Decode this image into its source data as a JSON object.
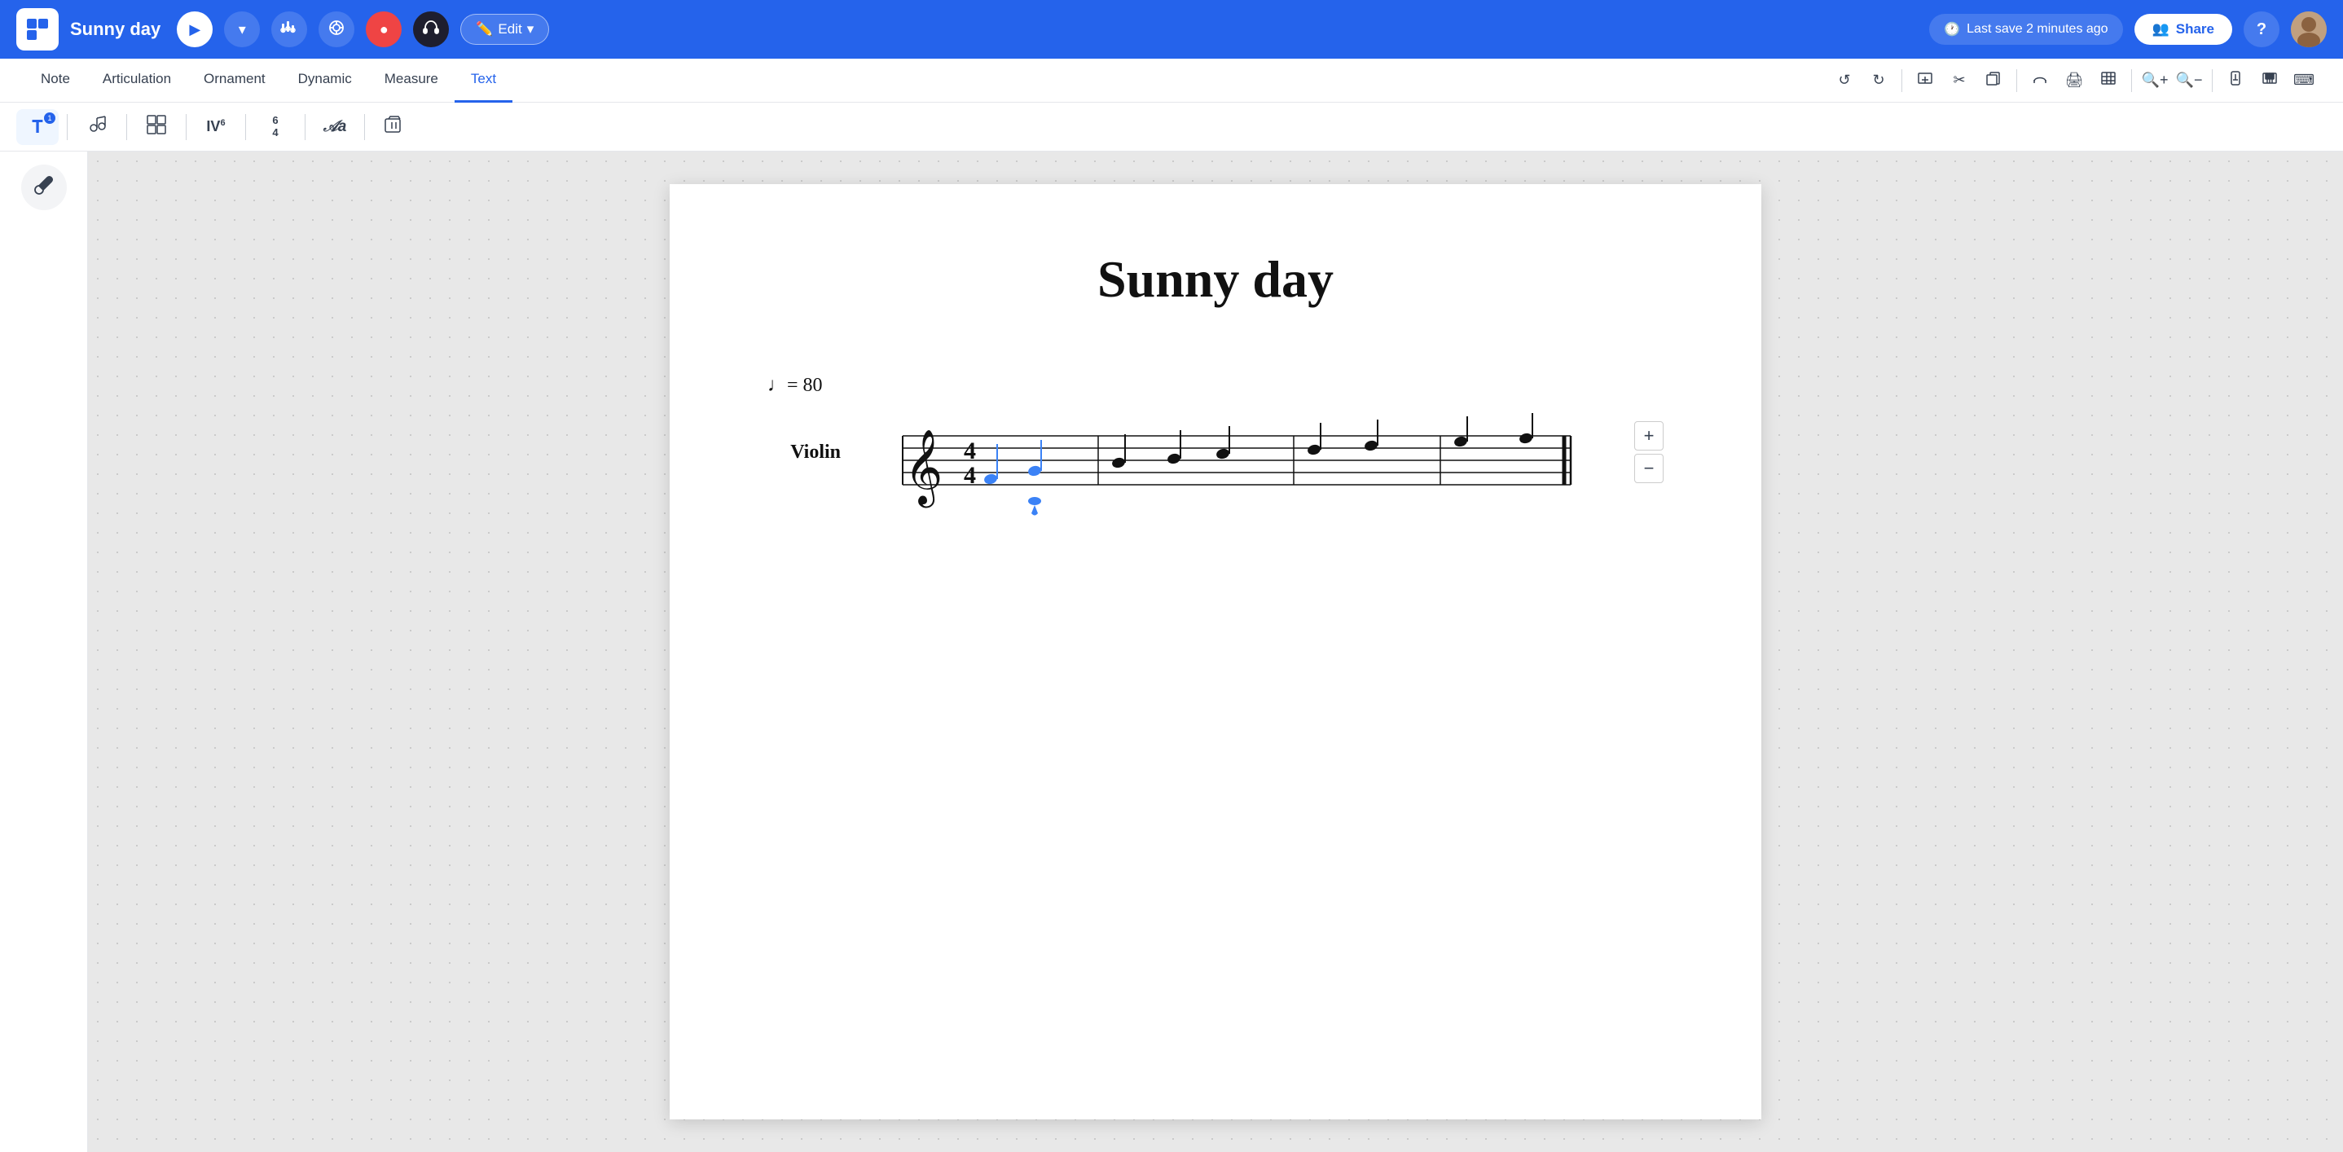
{
  "app": {
    "title": "Sunny day",
    "logo_symbol": "◱"
  },
  "header": {
    "title": "Sunny day",
    "play_label": "▶",
    "dropdown_label": "▾",
    "last_save_label": "Last save 2 minutes ago",
    "share_label": "Share",
    "help_label": "?",
    "edit_label": "Edit",
    "edit_dropdown": "▾"
  },
  "menubar": {
    "items": [
      {
        "id": "note",
        "label": "Note"
      },
      {
        "id": "articulation",
        "label": "Articulation"
      },
      {
        "id": "ornament",
        "label": "Ornament"
      },
      {
        "id": "dynamic",
        "label": "Dynamic"
      },
      {
        "id": "measure",
        "label": "Measure"
      },
      {
        "id": "text",
        "label": "Text",
        "active": true
      }
    ],
    "right_icons": [
      "undo",
      "redo",
      "divider",
      "add-measure",
      "cut",
      "copy",
      "divider",
      "slur",
      "print",
      "table",
      "divider",
      "zoom-in",
      "zoom-out",
      "divider",
      "metronome",
      "piano",
      "keyboard"
    ]
  },
  "toolbar": {
    "tools": [
      {
        "id": "text-info",
        "label": "ℹ",
        "has_badge": true,
        "badge_label": "1"
      },
      {
        "id": "divider1"
      },
      {
        "id": "lyrics",
        "label": "🎤"
      },
      {
        "id": "divider2"
      },
      {
        "id": "chord-grid",
        "label": "⊞"
      },
      {
        "id": "divider3"
      },
      {
        "id": "chord-symbol",
        "label": "IV⁶"
      },
      {
        "id": "divider4"
      },
      {
        "id": "time-sig",
        "label": "6/4"
      },
      {
        "id": "divider5"
      },
      {
        "id": "text-style",
        "label": "𝒜a"
      },
      {
        "id": "divider6"
      },
      {
        "id": "delete",
        "label": "⌫"
      }
    ]
  },
  "side": {
    "tool_icon": "🎨"
  },
  "score": {
    "title": "Sunny day",
    "tempo": "♩= 80",
    "instrument": "Violin"
  },
  "colors": {
    "blue_accent": "#2563eb",
    "blue_note": "#3b82f6",
    "active_tab": "#2563eb",
    "header_bg": "#2563eb"
  }
}
